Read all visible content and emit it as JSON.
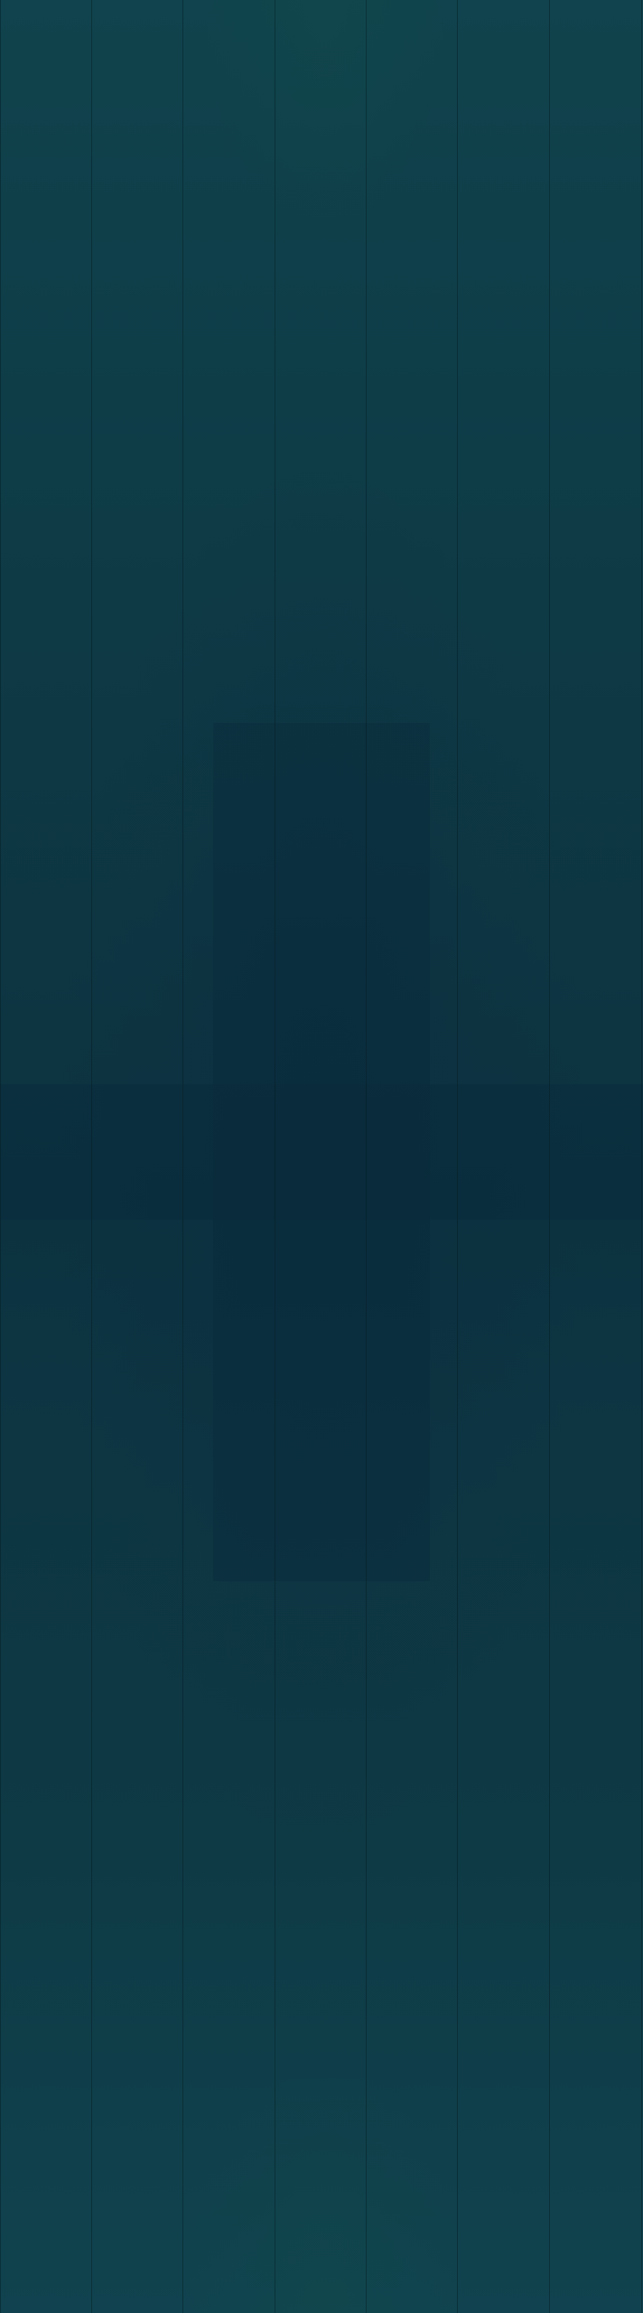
{
  "screen": {
    "background_color": "#0f3a45",
    "accent_dark": "#0c3240",
    "accent_teal": "#10434d"
  }
}
